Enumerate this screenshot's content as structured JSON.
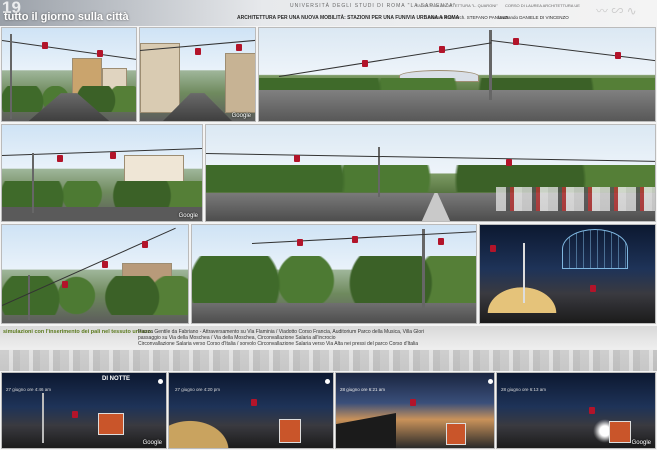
{
  "header": {
    "page_number": "19",
    "title": "tutto il giorno sulla città",
    "university": "UNIVERSITÀ DEGLI STUDI DI ROMA \"LA SAPIENZA\"",
    "faculty": "FACOLTÀ DI ARCHITETTURA \"L. QUARONI\"",
    "course": "CORSO DI LAUREA ARCHITETTURA UE",
    "project_title": "ARCHITETTURA PER UNA NUOVA MOBILITÀ: STAZIONI PER UNA FUNIVIA URBANA A ROMA",
    "advisor": "relatore Prof. Arch. STEFANO PANUNZI",
    "student": "laureando DANIELE DI VINCENZO"
  },
  "top_row": {
    "brand_watermark": "Google"
  },
  "middle_row": {
    "brand_watermark": "Google"
  },
  "caption": {
    "heading": "simulazioni con l'inserimento dei pali nel tessuto urbano:",
    "line1": "Piazza Gentile da Fabriano - Attraversamento su Via Flaminia / Viadotto Corso Francia, Auditorium Parco della Musica, Villa Glori",
    "line2": "passaggio su Via della Moschea / Via della Moschea, Circonvallazione Salaria all'incrocio",
    "line3": "Circonvallazione Salaria verso Corso d'Italia / sorvolo Circonvallazione Salaria verso Via Alta nei pressi del parco Corso d'Italia"
  },
  "bottom_row": {
    "night_label": "DI NOTTE",
    "times": [
      "27 giugno ore 4:46 am",
      "27 giugno ore 4:20 pm",
      "28 giugno ore 6:21 am",
      "28 giugno ore 6:13 am"
    ],
    "brand_watermark": "Google"
  },
  "colors": {
    "cabin": "#b2142a",
    "title": "#ffffff",
    "project": "#2a2a2a"
  }
}
